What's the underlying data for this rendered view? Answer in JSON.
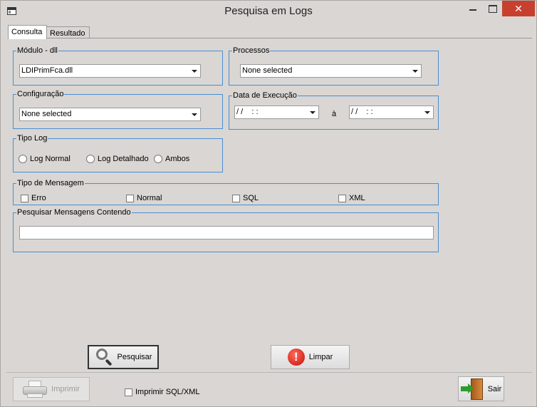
{
  "window": {
    "title": "Pesquisa em Logs",
    "close_glyph": "✕"
  },
  "tabs": [
    {
      "label": "Consulta",
      "active": true
    },
    {
      "label": "Resultado",
      "active": false
    }
  ],
  "modulo": {
    "title": "Módulo - dll",
    "value": "LDIPrimFca.dll"
  },
  "processos": {
    "title": "Processos",
    "value": "None selected"
  },
  "configuracao": {
    "title": "Configuração",
    "value": "None selected"
  },
  "data_execucao": {
    "title": "Data de Execução",
    "from": "/ /    : :",
    "separator": "à",
    "to": "/ /    : :"
  },
  "tipo_log": {
    "title": "Tipo Log",
    "options": [
      "Log Normal",
      "Log Detalhado",
      "Ambos"
    ]
  },
  "tipo_mensagem": {
    "title": "Tipo de Mensagem",
    "options": [
      "Erro",
      "Normal",
      "SQL",
      "XML"
    ]
  },
  "pesquisar_mensagens": {
    "title": "Pesquisar Mensagens Contendo",
    "value": ""
  },
  "buttons": {
    "pesquisar": "Pesquisar",
    "limpar": "Limpar",
    "imprimir": "Imprimir",
    "sair": "Sair"
  },
  "imprimir_sql_xml": {
    "label": "Imprimir SQL/XML",
    "checked": false
  },
  "colors": {
    "group_border": "#4a8ed1",
    "close_button": "#c7402e",
    "background": "#d9d6d3"
  },
  "icons": [
    "app-icon",
    "magnifier-icon",
    "stop-icon",
    "printer-icon",
    "exit-icon"
  ]
}
